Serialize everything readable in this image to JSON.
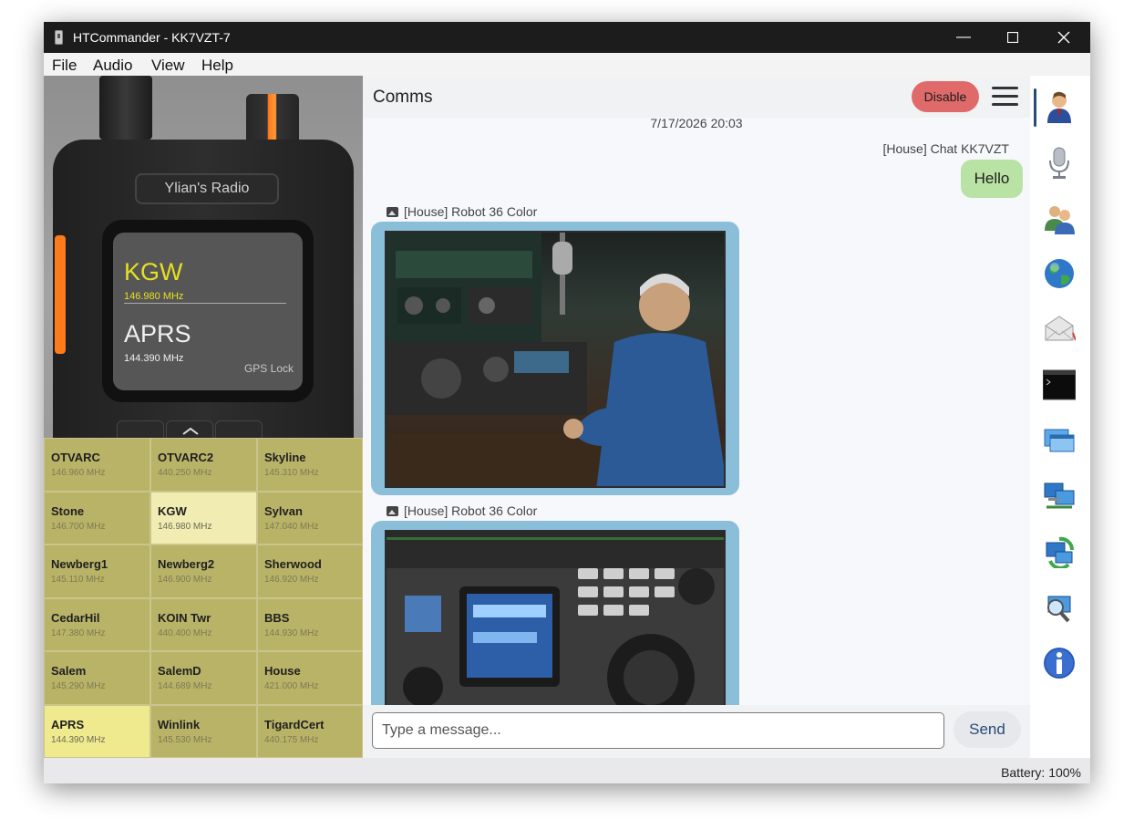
{
  "window": {
    "title": "HTCommander - KK7VZT-7"
  },
  "menu": [
    "File",
    "Audio",
    "View",
    "Help"
  ],
  "radio": {
    "brand": "Ylian's Radio",
    "vfo_a": {
      "name": "KGW",
      "freq": "146.980 MHz"
    },
    "vfo_b": {
      "name": "APRS",
      "freq": "144.390 MHz"
    },
    "gps": "GPS Lock",
    "colors": {
      "vfo_a": "#e5e021",
      "vfo_b": "#f0f0f0"
    }
  },
  "channels": [
    {
      "name": "OTVARC",
      "freq": "146.960 MHz",
      "state": "normal"
    },
    {
      "name": "OTVARC2",
      "freq": "440.250 MHz",
      "state": "normal"
    },
    {
      "name": "Skyline",
      "freq": "145.310 MHz",
      "state": "normal"
    },
    {
      "name": "Stone",
      "freq": "146.700 MHz",
      "state": "normal"
    },
    {
      "name": "KGW",
      "freq": "146.980 MHz",
      "state": "selected"
    },
    {
      "name": "Sylvan",
      "freq": "147.040 MHz",
      "state": "normal"
    },
    {
      "name": "Newberg1",
      "freq": "145.110 MHz",
      "state": "normal"
    },
    {
      "name": "Newberg2",
      "freq": "146.900 MHz",
      "state": "normal"
    },
    {
      "name": "Sherwood",
      "freq": "146.920 MHz",
      "state": "normal"
    },
    {
      "name": "CedarHil",
      "freq": "147.380 MHz",
      "state": "normal"
    },
    {
      "name": "KOIN Twr",
      "freq": "440.400 MHz",
      "state": "normal"
    },
    {
      "name": "BBS",
      "freq": "144.930 MHz",
      "state": "normal"
    },
    {
      "name": "Salem",
      "freq": "145.290 MHz",
      "state": "normal"
    },
    {
      "name": "SalemD",
      "freq": "144.689 MHz",
      "state": "normal"
    },
    {
      "name": "House",
      "freq": "421.000 MHz",
      "state": "normal"
    },
    {
      "name": "APRS",
      "freq": "144.390 MHz",
      "state": "active"
    },
    {
      "name": "Winlink",
      "freq": "145.530 MHz",
      "state": "normal"
    },
    {
      "name": "TigardCert",
      "freq": "440.175 MHz",
      "state": "normal"
    }
  ],
  "comms": {
    "title": "Comms",
    "disable_label": "Disable",
    "timestamp": "7/17/2026 20:03",
    "messages": [
      {
        "sender": "[House] Chat KK7VZT",
        "text": "Hello",
        "side": "right"
      },
      {
        "sender": "[House] Robot 36 Color",
        "type": "image",
        "side": "left"
      },
      {
        "sender": "[House] Robot 36 Color",
        "type": "image",
        "side": "left"
      }
    ],
    "input_placeholder": "Type a message...",
    "send_label": "Send"
  },
  "sidebar_icons": [
    "person-icon",
    "microphone-icon",
    "contacts-icon",
    "globe-icon",
    "mail-icon",
    "terminal-icon",
    "windows-icon",
    "network-icon",
    "sync-network-icon",
    "search-network-icon",
    "info-icon"
  ],
  "status": {
    "battery": "Battery: 100%"
  }
}
